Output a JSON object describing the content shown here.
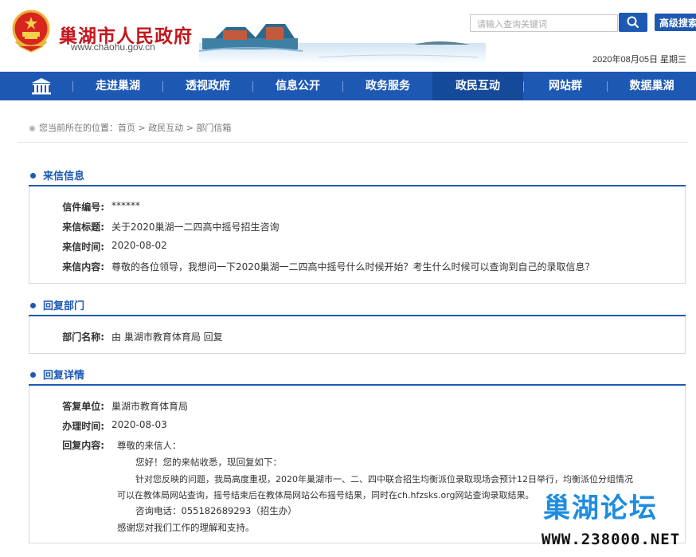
{
  "header": {
    "site_title": "巢湖市人民政府",
    "site_url": "www.chaohu.gov.cn",
    "search_placeholder": "请输入查询关键词",
    "advanced_search": "高级搜索",
    "date": "2020年08月05日 星期三"
  },
  "nav": {
    "items": [
      "走进巢湖",
      "透视政府",
      "信息公开",
      "政务服务",
      "政民互动",
      "网站群",
      "数据巢湖"
    ],
    "active": "政民互动"
  },
  "breadcrumb": {
    "prefix": "您当前所在的位置：",
    "items": [
      "首页",
      "政民互动",
      "部门信箱"
    ],
    "sep": " > "
  },
  "letter_info": {
    "title": "来信信息",
    "rows": [
      {
        "label": "信件编号:",
        "value": "******"
      },
      {
        "label": "来信标题:",
        "value": "关于2020巢湖一二四高中摇号招生咨询"
      },
      {
        "label": "来信时间:",
        "value": "2020-08-02"
      },
      {
        "label": "来信内容:",
        "value": "尊敬的各位领导，我想问一下2020巢湖一二四高中摇号什么时候开始？考生什么时候可以查询到自己的录取信息？"
      }
    ]
  },
  "reply_dept": {
    "title": "回复部门",
    "label": "部门名称:",
    "value": "由 巢湖市教育体育局 回复"
  },
  "reply_detail": {
    "title": "回复详情",
    "unit_label": "答复单位:",
    "unit_value": "巢湖市教育体育局",
    "time_label": "办理时间:",
    "time_value": "2020-08-03",
    "content_label": "回复内容:",
    "content_lines": [
      "尊敬的来信人：",
      "您好！您的来帖收悉，现回复如下：",
      "针对您反映的问题，我局高度重视，2020年巢湖市一、二、四中联合招生均衡派位录取现场会预计12日举行，均衡派位分组情况",
      "可以在教体局网站查询，摇号结束后在教体局网站公布摇号结果，同时在ch.hfzsks.org网站查询录取结果。",
      "咨询电话：05518268929​3（招生办）",
      "感谢您对我们工作的理解和支持。"
    ]
  },
  "watermark": {
    "name": "巢湖论坛",
    "url": "WWW.238000.NET"
  }
}
